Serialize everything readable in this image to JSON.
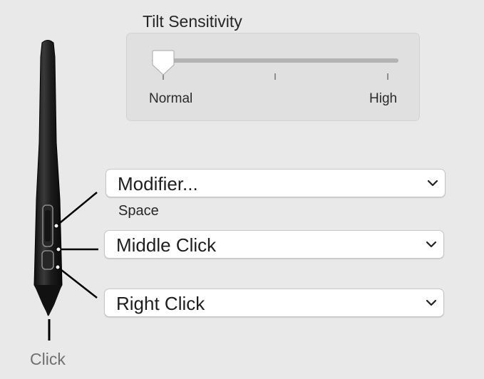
{
  "tilt_sensitivity": {
    "title": "Tilt Sensitivity",
    "min_label": "Normal",
    "max_label": "High",
    "value": 0
  },
  "buttons": {
    "upper": {
      "selected": "Modifier...",
      "sub_label": "Space"
    },
    "middle": {
      "selected": "Middle Click"
    },
    "lower": {
      "selected": "Right Click"
    }
  },
  "tip": {
    "label": "Click"
  },
  "colors": {
    "background": "#e9e9e9",
    "panel": "#e0e0e0",
    "pen_body": "#1a1a1a"
  }
}
